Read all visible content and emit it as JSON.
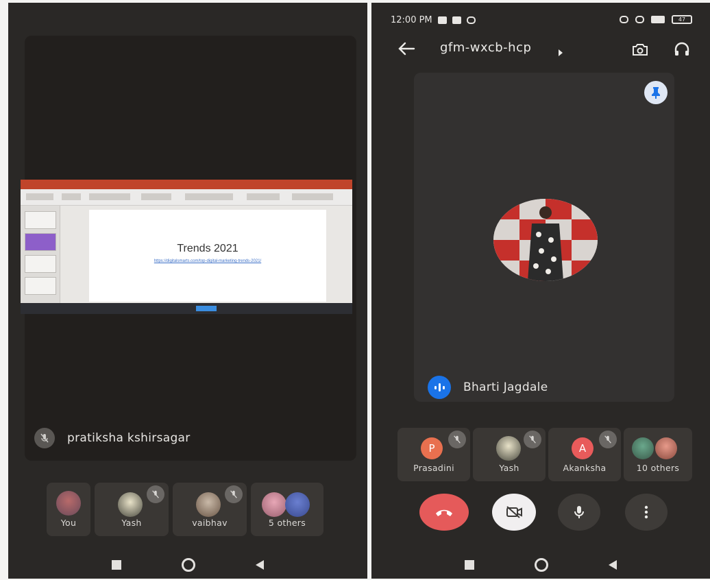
{
  "left": {
    "presenter_name": "pratiksha kshirsagar",
    "slide_title": "Trends  2021",
    "slide_link": "https://digitalsmarts.com/top-digital-marketing-trends-2021/",
    "participants": [
      {
        "name": "You"
      },
      {
        "name": "Yash"
      },
      {
        "name": "vaibhav"
      },
      {
        "name": "5 others"
      }
    ]
  },
  "right": {
    "status_time": "12:00 PM",
    "battery": "47",
    "meeting_code": "gfm-wxcb-hcp",
    "speaker_name": "Bharti Jagdale",
    "participants": [
      {
        "name": "Prasadini",
        "initial": "P"
      },
      {
        "name": "Yash"
      },
      {
        "name": "Akanksha",
        "initial": "A"
      },
      {
        "name": "10 others"
      }
    ]
  },
  "colors": {
    "background": "#2a2826",
    "tile": "#3a3734",
    "end_call": "#e55a5a",
    "speaking": "#1a73e8",
    "avatar_letter": "#e8704f"
  },
  "icons": [
    "mic-off-icon",
    "back-arrow-icon",
    "switch-camera-icon",
    "headphones-icon",
    "pin-icon",
    "speaking-icon",
    "end-call-icon",
    "camera-off-icon",
    "mic-icon",
    "more-vert-icon"
  ]
}
